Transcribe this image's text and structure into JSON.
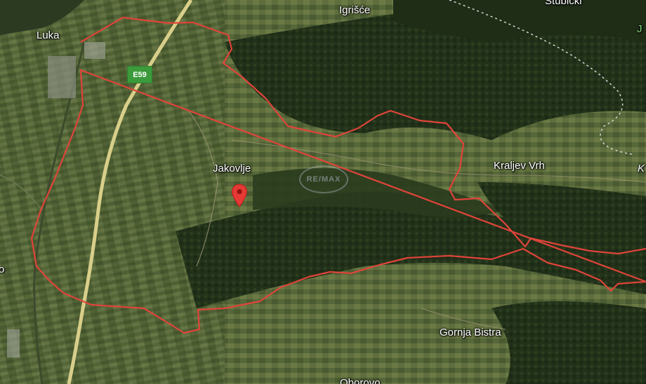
{
  "map": {
    "places": {
      "luka": "Luka",
      "igrisce": "Igrišće",
      "stubicki": "Stubički",
      "jakovlje": "Jakovlje",
      "kraljev_vrh": "Kraljev Vrh",
      "gornja_bistra": "Gornja Bistra",
      "oborovo": "Oborovo",
      "edge_j": "J",
      "edge_k": "K",
      "edge_o": "o"
    },
    "road_shield": "E59",
    "watermark": "RE/MAX",
    "colors": {
      "boundary": "#e0443a",
      "pin": "#e53935",
      "shield": "#3b9a3a",
      "highway": "#d9cf8a",
      "forest": "#25351d",
      "farmland": "#5b6b3c"
    }
  }
}
